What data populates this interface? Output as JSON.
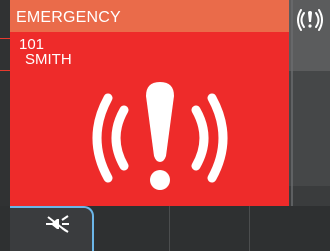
{
  "alert": {
    "title": "EMERGENCY",
    "caller_number": "101",
    "caller_name": "SMITH",
    "icon": "emergency-alarm-icon"
  },
  "status_bar": {
    "icon": "alarm-ringing-icon"
  },
  "softkeys": [
    {
      "icon": "speaker-mute-icon",
      "active": true
    },
    {
      "icon": "",
      "active": false
    },
    {
      "icon": "",
      "active": false
    },
    {
      "icon": "",
      "active": false
    }
  ],
  "colors": {
    "alert_red": "#ee2b2a",
    "title_bar": "#ea6b4a",
    "accent_blue": "#6cb6e8"
  }
}
